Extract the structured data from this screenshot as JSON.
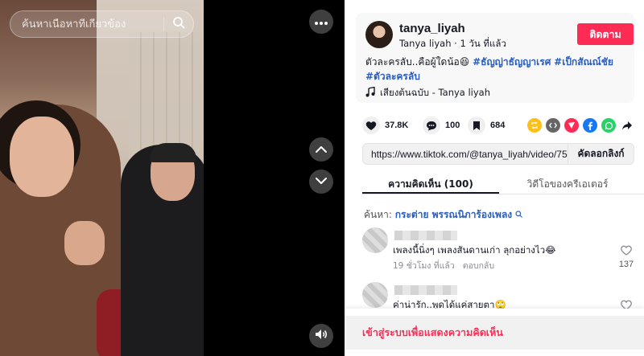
{
  "video": {
    "search_placeholder": "ค้นหาเนื้อหาที่เกี่ยวข้อง"
  },
  "post": {
    "username": "tanya_liyah",
    "display_name": "Tanya liyah",
    "separator": "·",
    "time_ago": "1 วัน ที่แล้ว",
    "follow_label": "ติดตาม",
    "caption_text": "ตัวละครลับ..คือผู้ใดน้อ😆",
    "hashtags": [
      "#ธัญญ่าธัญญาเรศ",
      "#เป็กสัณณ์ชัย",
      "#ตัวละครลับ"
    ],
    "music_label": "เสียงต้นฉบับ - Tanya liyah"
  },
  "actions": {
    "likes": "37.8K",
    "comments": "100",
    "saves": "684"
  },
  "share_colors": [
    "#fdbf18",
    "#666666",
    "#fe2c55",
    "#1877f2",
    "#25d366"
  ],
  "link": {
    "url": "https://www.tiktok.com/@tanya_liyah/video/75720...",
    "copy_label": "คัดลอกลิงก์"
  },
  "tabs": {
    "comments": "ความคิดเห็น (100)",
    "creator_videos": "วิดีโอของครีเอเตอร์"
  },
  "search_suggest": {
    "prefix": "ค้นหา:",
    "query": "กระต่าย พรรณนิภาร้องเพลง"
  },
  "comments": [
    {
      "text": "เพลงนี้นิ่งๆ เพลงสันดานเก่า ลุกอย่างไว😂",
      "time": "19 ชั่วโมง ที่แล้ว",
      "reply_label": "ตอบกลับ",
      "likes": "137"
    },
    {
      "text": "ค่าน่ารัก..พูดได้แค่สายตา🙄",
      "time": "",
      "reply_label": "",
      "likes": ""
    }
  ],
  "login_prompt": "เข้าสู่ระบบเพื่อแสดงความคิดเห็น"
}
